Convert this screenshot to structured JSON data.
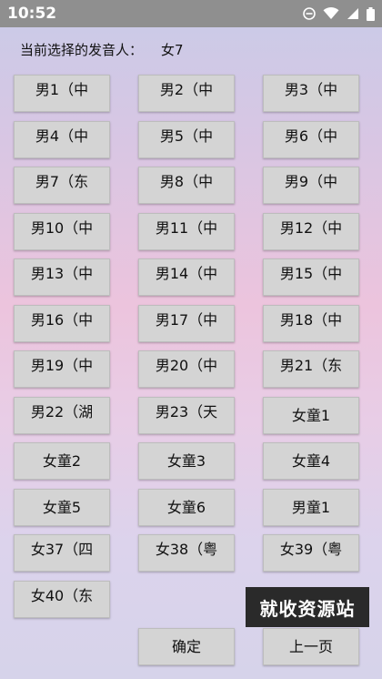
{
  "status_bar": {
    "time": "10:52",
    "icons": [
      "dnd-icon",
      "wifi-icon",
      "signal-icon",
      "battery-icon"
    ]
  },
  "speaker": {
    "label": "当前选择的发音人：",
    "value": "女7"
  },
  "voices": [
    "男1（中",
    "男2（中",
    "男3（中",
    "男4（中",
    "男5（中",
    "男6（中",
    "男7（东",
    "男8（中",
    "男9（中",
    "男10（中",
    "男11（中",
    "男12（中",
    "男13（中",
    "男14（中",
    "男15（中",
    "男16（中",
    "男17（中",
    "男18（中",
    "男19（中",
    "男20（中",
    "男21（东",
    "男22（湖",
    "男23（天",
    "女童1",
    "女童2",
    "女童3",
    "女童4",
    "女童5",
    "女童6",
    "男童1",
    "女37（四",
    "女38（粤",
    "女39（粤",
    "女40（东"
  ],
  "actions": {
    "confirm": "确定",
    "prev_page": "上一页"
  },
  "watermark": "就收资源站"
}
